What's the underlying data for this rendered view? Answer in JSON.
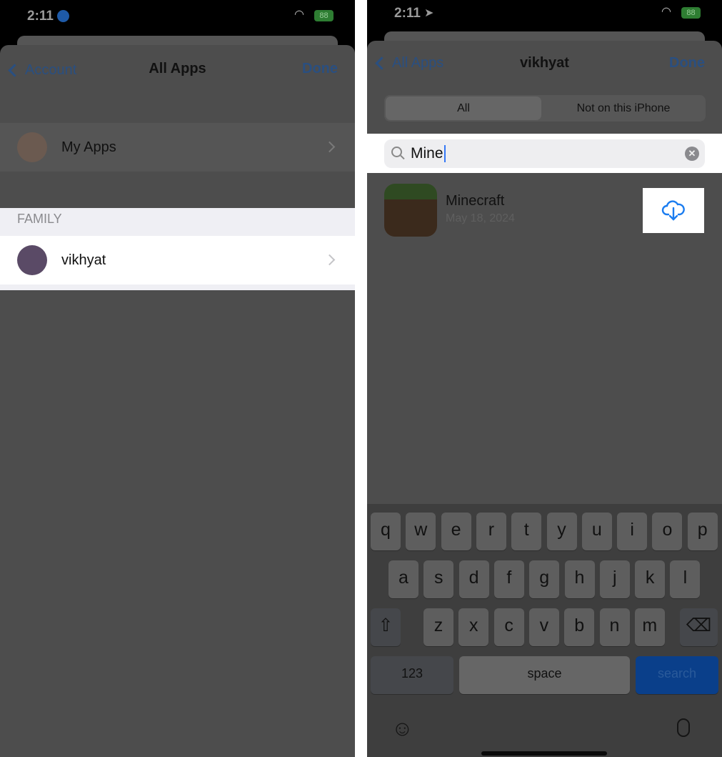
{
  "left": {
    "status": {
      "time": "2:11",
      "battery": "88"
    },
    "nav": {
      "back": "Account",
      "title": "All Apps",
      "done": "Done"
    },
    "my_apps": "My Apps",
    "section": "FAMILY",
    "member": "vikhyat"
  },
  "right": {
    "status": {
      "time": "2:11",
      "battery": "88"
    },
    "nav": {
      "back": "All Apps",
      "title": "vikhyat",
      "done": "Done"
    },
    "segments": [
      "All",
      "Not on this iPhone"
    ],
    "search": {
      "value": "Mine"
    },
    "result": {
      "name": "Minecraft",
      "date": "May 18, 2024",
      "action_icon": "cloud-download-icon"
    },
    "keyboard": {
      "row1": [
        "q",
        "w",
        "e",
        "r",
        "t",
        "y",
        "u",
        "i",
        "o",
        "p"
      ],
      "row2": [
        "a",
        "s",
        "d",
        "f",
        "g",
        "h",
        "j",
        "k",
        "l"
      ],
      "row3": [
        "z",
        "x",
        "c",
        "v",
        "b",
        "n",
        "m"
      ],
      "numbers": "123",
      "space": "space",
      "search": "search"
    }
  },
  "colors": {
    "accent": "#007aff",
    "dim_bg": "#4d4d4d",
    "search_key": "#0a3f8a"
  }
}
